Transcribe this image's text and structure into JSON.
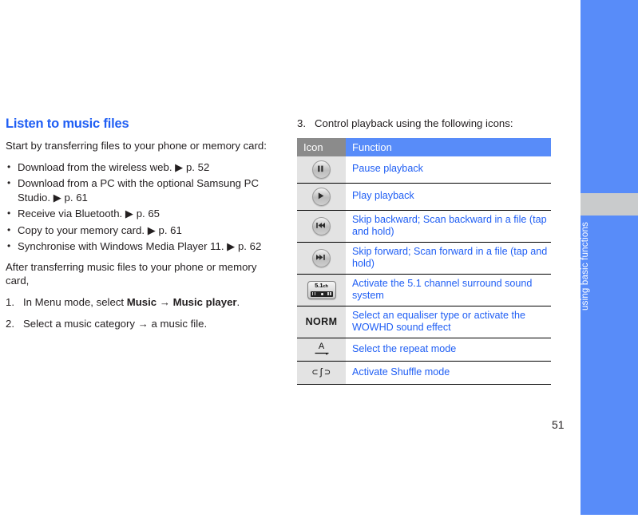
{
  "chapter_tab": {
    "label": "using basic functions",
    "bar_color": "#588cf9",
    "marker_color": "#c9cbcc"
  },
  "page_number": "51",
  "left_column": {
    "heading": "Listen to music files",
    "intro": "Start by transferring files to your phone or memory card:",
    "bullets": [
      "Download from the wireless web. ▶ p. 52",
      "Download from a PC with the optional Samsung PC Studio. ▶ p. 61",
      "Receive via Bluetooth. ▶ p. 65",
      "Copy to your memory card. ▶ p. 61",
      "Synchronise with Windows Media Player 11. ▶ p. 62"
    ],
    "after_text": "After transferring music files to your phone or memory card,",
    "steps": [
      {
        "num": "1.",
        "prefix": "In Menu mode, select ",
        "bold1": "Music",
        "mid": " → ",
        "bold2": "Music player",
        "suffix": "."
      },
      {
        "num": "2.",
        "prefix": "Select a music category → a music file.",
        "bold1": "",
        "mid": "",
        "bold2": "",
        "suffix": ""
      }
    ]
  },
  "right_column": {
    "step3_num": "3.",
    "step3_text": "Control playback using the following icons:",
    "table": {
      "headers": {
        "icon": "Icon",
        "function": "Function"
      },
      "header_icon_bg": "#8b8b8b",
      "header_function_bg": "#588cf9",
      "function_text_color": "#1f5ef4",
      "rows": [
        {
          "icon": "pause-icon",
          "function": "Pause playback"
        },
        {
          "icon": "play-icon",
          "function": "Play playback"
        },
        {
          "icon": "skip-backward-icon",
          "function": "Skip backward; Scan backward in a file (tap and hold)"
        },
        {
          "icon": "skip-forward-icon",
          "function": "Skip forward; Scan forward in a file (tap and hold)"
        },
        {
          "icon": "surround-5-1-channel-icon",
          "function": "Activate the 5.1 channel surround sound system",
          "icon_text": "5.1",
          "icon_text_sub": "ch"
        },
        {
          "icon": "equaliser-norm-icon",
          "function": "Select an equaliser type or activate the WOWHD sound effect",
          "icon_text": "NORM"
        },
        {
          "icon": "repeat-mode-icon",
          "function": "Select the repeat mode",
          "icon_text": "A"
        },
        {
          "icon": "shuffle-mode-icon",
          "function": "Activate Shuffle mode",
          "icon_text": "⊂ʃ⊃"
        }
      ]
    }
  }
}
